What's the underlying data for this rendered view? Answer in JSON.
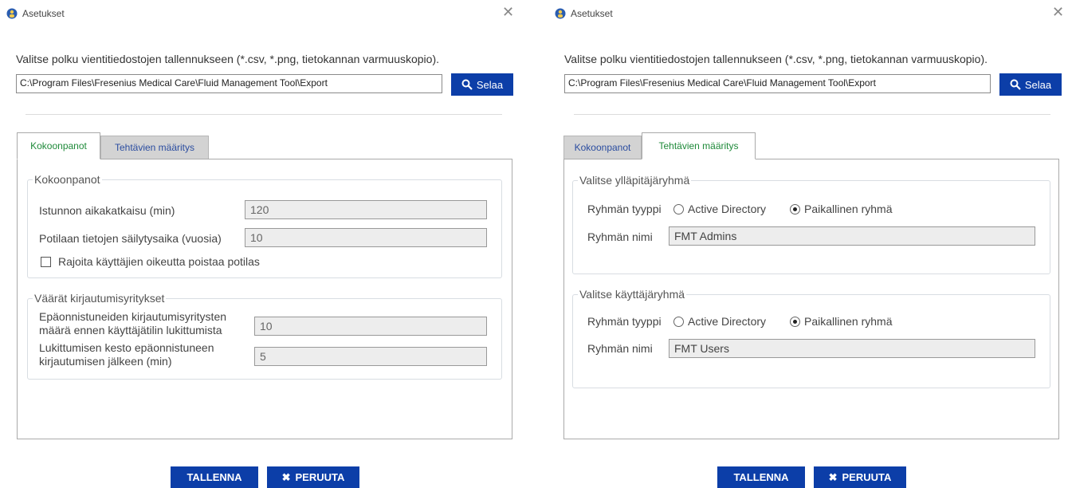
{
  "colors": {
    "accent": "#0c3ea8",
    "active_tab_text": "#1f8a3a",
    "inactive_tab_text": "#2b4da0"
  },
  "dialogs": [
    {
      "title": "Asetukset",
      "path_label": "Valitse polku vientitiedostojen tallennukseen (*.csv, *.png, tietokannan varmuuskopio).",
      "path_value": "C:\\Program Files\\Fresenius Medical Care\\Fluid Management Tool\\Export",
      "browse_label": "Selaa",
      "tabs": [
        {
          "label": "Kokoonpanot",
          "active": true
        },
        {
          "label": "Tehtävien määritys",
          "active": false
        }
      ],
      "config_group": {
        "legend": "Kokoonpanot",
        "session_timeout_label": "Istunnon aikakatkaisu (min)",
        "session_timeout_value": "120",
        "retention_label": "Potilaan tietojen säilytysaika (vuosia)",
        "retention_value": "10",
        "restrict_label": "Rajoita käyttäjien oikeutta poistaa potilas",
        "restrict_checked": false
      },
      "login_group": {
        "legend": "Väärät kirjautumisyritykset",
        "attempts_label_1": "Epäonnistuneiden kirjautumisyritysten",
        "attempts_label_2": "määrä ennen käyttäjätilin lukittumista",
        "attempts_value": "10",
        "lock_label_1": "Lukittumisen kesto epäonnistuneen",
        "lock_label_2": "kirjautumisen jälkeen (min)",
        "lock_value": "5"
      },
      "save_label": "TALLENNA",
      "cancel_label": "PERUUTA"
    },
    {
      "title": "Asetukset",
      "path_label": "Valitse polku vientitiedostojen tallennukseen (*.csv, *.png, tietokannan varmuuskopio).",
      "path_value": "C:\\Program Files\\Fresenius Medical Care\\Fluid Management Tool\\Export",
      "browse_label": "Selaa",
      "tabs": [
        {
          "label": "Kokoonpanot",
          "active": false
        },
        {
          "label": "Tehtävien määritys",
          "active": true
        }
      ],
      "admin_group": {
        "legend": "Valitse ylläpitäjäryhmä",
        "type_label": "Ryhmän tyyppi",
        "option_ad": "Active Directory",
        "option_local": "Paikallinen ryhmä",
        "selected": "Paikallinen ryhmä",
        "name_label": "Ryhmän nimi",
        "name_value": "FMT Admins"
      },
      "user_group": {
        "legend": "Valitse käyttäjäryhmä",
        "type_label": "Ryhmän tyyppi",
        "option_ad": "Active Directory",
        "option_local": "Paikallinen ryhmä",
        "selected": "Paikallinen ryhmä",
        "name_label": "Ryhmän nimi",
        "name_value": "FMT Users"
      },
      "save_label": "TALLENNA",
      "cancel_label": "PERUUTA"
    }
  ]
}
